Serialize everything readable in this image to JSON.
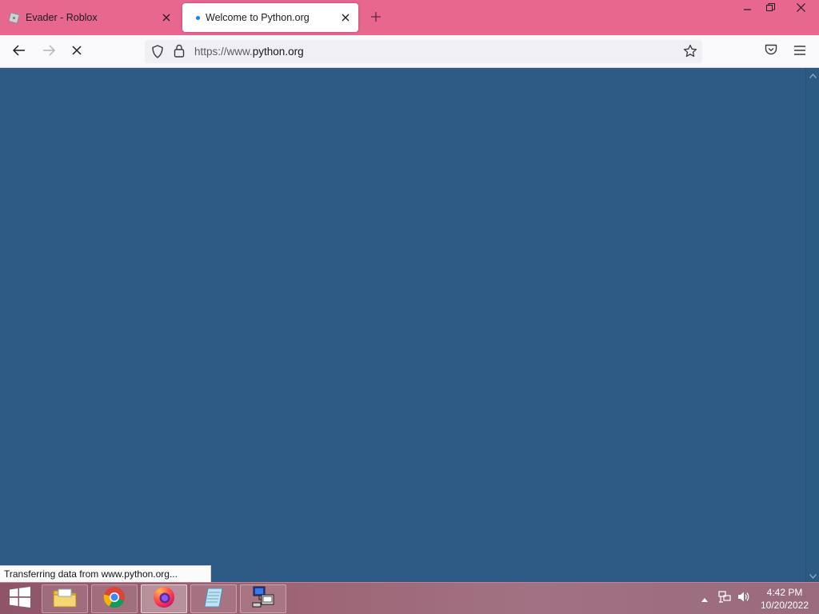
{
  "browser": {
    "tabs": [
      {
        "title": "Evader - Roblox",
        "active": false,
        "favicon": "roblox-icon"
      },
      {
        "title": "Welcome to Python.org",
        "active": true,
        "loading": true
      }
    ],
    "new_tab_icon": "plus-icon",
    "window_controls": [
      "minimize-icon",
      "restore-icon",
      "close-icon"
    ],
    "tab_strip_color": "#e8678f"
  },
  "navigation": {
    "url_prefix": "https://www.",
    "url_domain": "python.org",
    "icons": [
      "back-arrow-icon",
      "forward-arrow-icon",
      "stop-loading-icon",
      "shield-icon",
      "lock-icon",
      "star-icon",
      "pocket-icon",
      "hamburger-menu-icon"
    ]
  },
  "page": {
    "background_color": "#2d5b85",
    "status_text": "Transferring data from www.python.org..."
  },
  "taskbar": {
    "pinned": [
      {
        "name": "file-explorer-icon",
        "active": false
      },
      {
        "name": "chrome-icon",
        "active": false
      },
      {
        "name": "firefox-icon",
        "active": true
      },
      {
        "name": "notepad-icon",
        "active": false
      },
      {
        "name": "network-setup-icon",
        "active": false
      }
    ],
    "tray_icons": [
      "show-hidden-icons-arrow",
      "network-icon",
      "volume-icon"
    ],
    "time": "4:42 PM",
    "date": "10/20/2022"
  }
}
